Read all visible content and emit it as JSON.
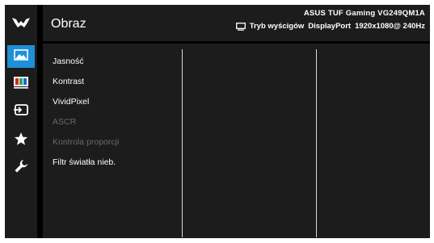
{
  "header": {
    "title": "Obraz",
    "model": "ASUS TUF Gaming  VG249QM1A",
    "mode_label": "Tryb wyścigów",
    "input": "DisplayPort",
    "resolution": "1920x1080@ 240Hz"
  },
  "sidebar": {
    "items": [
      {
        "icon": "tuf-logo-icon"
      },
      {
        "icon": "image-icon",
        "active": true
      },
      {
        "icon": "color-icon"
      },
      {
        "icon": "input-select-icon"
      },
      {
        "icon": "star-icon"
      },
      {
        "icon": "wrench-icon"
      }
    ]
  },
  "menu": {
    "items": [
      {
        "label": "Jasność",
        "enabled": true
      },
      {
        "label": "Kontrast",
        "enabled": true
      },
      {
        "label": "VividPixel",
        "enabled": true
      },
      {
        "label": "ASCR",
        "enabled": false
      },
      {
        "label": "Kontrola proporcji",
        "enabled": false
      },
      {
        "label": "Filtr światła nieb.",
        "enabled": true
      }
    ]
  },
  "colors": {
    "accent": "#1e8fd8",
    "panel": "#1c1c1c",
    "background": "#000000",
    "text": "#ffffff",
    "disabled_text": "#6a6a6a"
  }
}
